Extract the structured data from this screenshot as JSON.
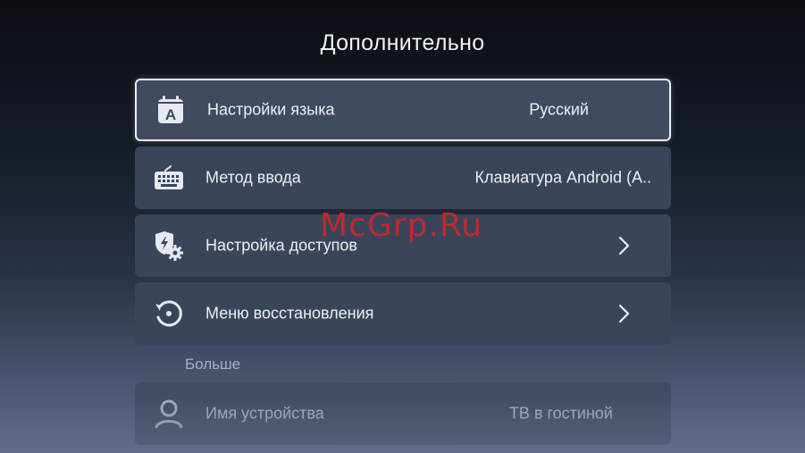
{
  "header": {
    "title": "Дополнительно"
  },
  "settings": [
    {
      "label": "Настройки языка",
      "value": "Русский",
      "icon": "language-icon",
      "focused": true
    },
    {
      "label": "Метод ввода",
      "value": "Клавиатура Android (A..",
      "icon": "keyboard-icon"
    },
    {
      "label": "Настройка доступов",
      "icon": "permissions-gear-icon",
      "chevron": "chevron-right-icon"
    },
    {
      "label": "Меню восстановления",
      "icon": "restore-icon",
      "chevron": "chevron-right-icon"
    }
  ],
  "more_section": {
    "title": "Больше",
    "items": [
      {
        "label": "Имя устройства",
        "value": "ТВ в гостиной",
        "icon": "person-icon"
      }
    ]
  },
  "watermark": "McGrp.Ru",
  "colors": {
    "row_background": "#3a445a",
    "focus_border": "#e9ecf2",
    "watermark": "#d62626",
    "text": "#eef0f4"
  }
}
